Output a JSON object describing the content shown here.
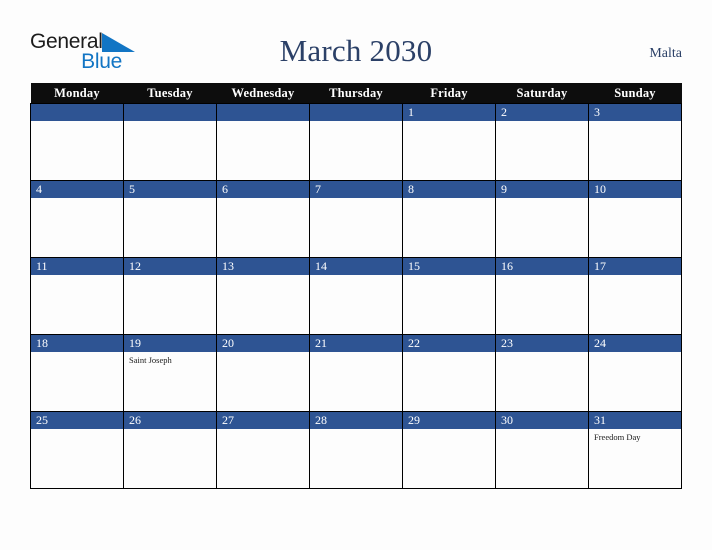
{
  "brand": {
    "name_part1": "General",
    "name_part2": "Blue",
    "triangle_color": "#1275c4"
  },
  "header": {
    "title": "March 2030",
    "country": "Malta",
    "title_color": "#2b4067"
  },
  "theme": {
    "header_row_bg": "#0d0d0d",
    "day_banner_bg": "#2e5493",
    "cell_bg": "#fdfdfd",
    "page_bg": "#fdfdfd",
    "border_color": "#000000"
  },
  "calendar": {
    "month": "March",
    "year": "2030",
    "weekday_headers": [
      "Monday",
      "Tuesday",
      "Wednesday",
      "Thursday",
      "Friday",
      "Saturday",
      "Sunday"
    ],
    "weeks": [
      [
        {
          "day": "",
          "events": []
        },
        {
          "day": "",
          "events": []
        },
        {
          "day": "",
          "events": []
        },
        {
          "day": "",
          "events": []
        },
        {
          "day": "1",
          "events": []
        },
        {
          "day": "2",
          "events": []
        },
        {
          "day": "3",
          "events": []
        }
      ],
      [
        {
          "day": "4",
          "events": []
        },
        {
          "day": "5",
          "events": []
        },
        {
          "day": "6",
          "events": []
        },
        {
          "day": "7",
          "events": []
        },
        {
          "day": "8",
          "events": []
        },
        {
          "day": "9",
          "events": []
        },
        {
          "day": "10",
          "events": []
        }
      ],
      [
        {
          "day": "11",
          "events": []
        },
        {
          "day": "12",
          "events": []
        },
        {
          "day": "13",
          "events": []
        },
        {
          "day": "14",
          "events": []
        },
        {
          "day": "15",
          "events": []
        },
        {
          "day": "16",
          "events": []
        },
        {
          "day": "17",
          "events": []
        }
      ],
      [
        {
          "day": "18",
          "events": []
        },
        {
          "day": "19",
          "events": [
            "Saint Joseph"
          ]
        },
        {
          "day": "20",
          "events": []
        },
        {
          "day": "21",
          "events": []
        },
        {
          "day": "22",
          "events": []
        },
        {
          "day": "23",
          "events": []
        },
        {
          "day": "24",
          "events": []
        }
      ],
      [
        {
          "day": "25",
          "events": []
        },
        {
          "day": "26",
          "events": []
        },
        {
          "day": "27",
          "events": []
        },
        {
          "day": "28",
          "events": []
        },
        {
          "day": "29",
          "events": []
        },
        {
          "day": "30",
          "events": []
        },
        {
          "day": "31",
          "events": [
            "Freedom Day"
          ]
        }
      ]
    ]
  }
}
